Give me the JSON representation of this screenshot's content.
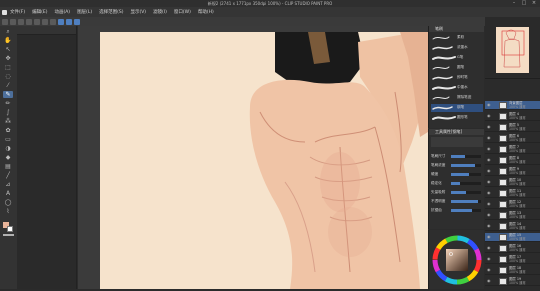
{
  "window": {
    "title": "新规2 (2741 x 1771px 350dpi 100%) - CLIP STUDIO PAINT PRO",
    "minimize_icon": "minimize-icon",
    "maximize_icon": "maximize-icon",
    "close_icon": "close-icon"
  },
  "menu": {
    "items": [
      "文件(F)",
      "编辑(E)",
      "动画(A)",
      "图层(L)",
      "选择范围(S)",
      "显示(V)",
      "滤镜(I)",
      "窗口(W)",
      "帮助(H)"
    ]
  },
  "brush_panel": {
    "tab_label": "笔刷",
    "brushes": [
      {
        "name": "柔软",
        "selected": false
      },
      {
        "name": "浓墨水",
        "selected": false
      },
      {
        "name": "G笔",
        "selected": false
      },
      {
        "name": "圆笔",
        "selected": false
      },
      {
        "name": "即时笔",
        "selected": false
      },
      {
        "name": "中墨水",
        "selected": false
      },
      {
        "name": "擦除笔迹",
        "selected": false
      },
      {
        "name": "钢笔",
        "selected": true
      },
      {
        "name": "圆形笔",
        "selected": false
      }
    ]
  },
  "tool_property": {
    "tab_label": "工具属性[钢笔]",
    "tool_name": "钢笔",
    "rows": [
      {
        "label": "笔刷尺寸",
        "value": 0.45
      },
      {
        "label": "笔刷浓度",
        "value": 0.8
      },
      {
        "label": "硬度",
        "value": 0.6
      },
      {
        "label": "稳定化",
        "value": 0.3
      },
      {
        "label": "矢量吸附",
        "value": 0.5
      },
      {
        "label": "不透明度",
        "value": 0.9
      },
      {
        "label": "抗锯齿",
        "value": 0.7
      }
    ]
  },
  "layers": {
    "rows": [
      {
        "name": "背景图层",
        "mode": "100% 通常",
        "selected": true
      },
      {
        "name": "图层 4",
        "mode": "100% 通常",
        "selected": false
      },
      {
        "name": "图层 5",
        "mode": "100% 通常",
        "selected": false
      },
      {
        "name": "图层 6",
        "mode": "100% 通常",
        "selected": false
      },
      {
        "name": "图层 7",
        "mode": "100% 通常",
        "selected": false
      },
      {
        "name": "图层 8",
        "mode": "100% 通常",
        "selected": false
      },
      {
        "name": "图层 9",
        "mode": "100% 通常",
        "selected": false
      },
      {
        "name": "图层 10",
        "mode": "100% 通常",
        "selected": false
      },
      {
        "name": "图层 11",
        "mode": "100% 通常",
        "selected": false
      },
      {
        "name": "图层 12",
        "mode": "100% 通常",
        "selected": false
      },
      {
        "name": "图层 13",
        "mode": "100% 通常",
        "selected": false
      },
      {
        "name": "图层 14",
        "mode": "100% 通常",
        "selected": false
      },
      {
        "name": "图层 15",
        "mode": "100% 通常",
        "selected": true
      },
      {
        "name": "图层 16",
        "mode": "100% 通常",
        "selected": false
      },
      {
        "name": "图层 17",
        "mode": "100% 通常",
        "selected": false
      },
      {
        "name": "图层 18",
        "mode": "100% 通常",
        "selected": false
      },
      {
        "name": "图层 19",
        "mode": "100% 通常",
        "selected": false
      }
    ]
  },
  "colors": {
    "accent": "#4f7fbf",
    "canvas_bg": "#f6e3cc",
    "skin": "#f0c7a8",
    "skin_shadow": "#d79c83",
    "hair": "#1a1a1a",
    "main_color": "#e8b49a",
    "sub_color": "#ffffff"
  }
}
